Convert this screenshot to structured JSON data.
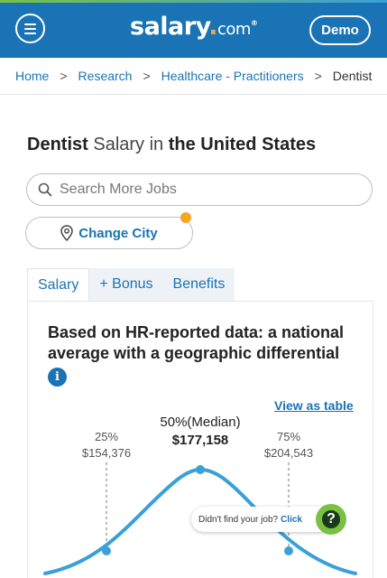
{
  "header": {
    "logo_main": "salary",
    "logo_suffix": "com",
    "logo_reg": "®",
    "demo_label": "Demo",
    "colors": {
      "bar": "#1a73b5",
      "accent": "#7ac143",
      "dot": "#f5a623"
    }
  },
  "breadcrumb": {
    "items": [
      "Home",
      "Research",
      "Healthcare - Practitioners"
    ],
    "current": "Dentist",
    "separator": ">"
  },
  "title": {
    "job": "Dentist",
    "word": "Salary in",
    "location": "the United States"
  },
  "search": {
    "placeholder": "Search More Jobs"
  },
  "city": {
    "label": "Change City"
  },
  "tabs": [
    "Salary",
    "+ Bonus",
    "Benefits"
  ],
  "card": {
    "heading": "Based on HR-reported data: a national average with a geographic differential",
    "info_icon": "i",
    "view_table": "View as table"
  },
  "distribution": {
    "p25": {
      "label": "25%",
      "value": "$154,376"
    },
    "p50": {
      "label": "50%(Median)",
      "value": "$177,158"
    },
    "p75": {
      "label": "75%",
      "value": "$204,543"
    },
    "curve_color": "#3aa0d8"
  },
  "help": {
    "text": "Didn't find your job?",
    "click": "Click",
    "icon": "?"
  }
}
